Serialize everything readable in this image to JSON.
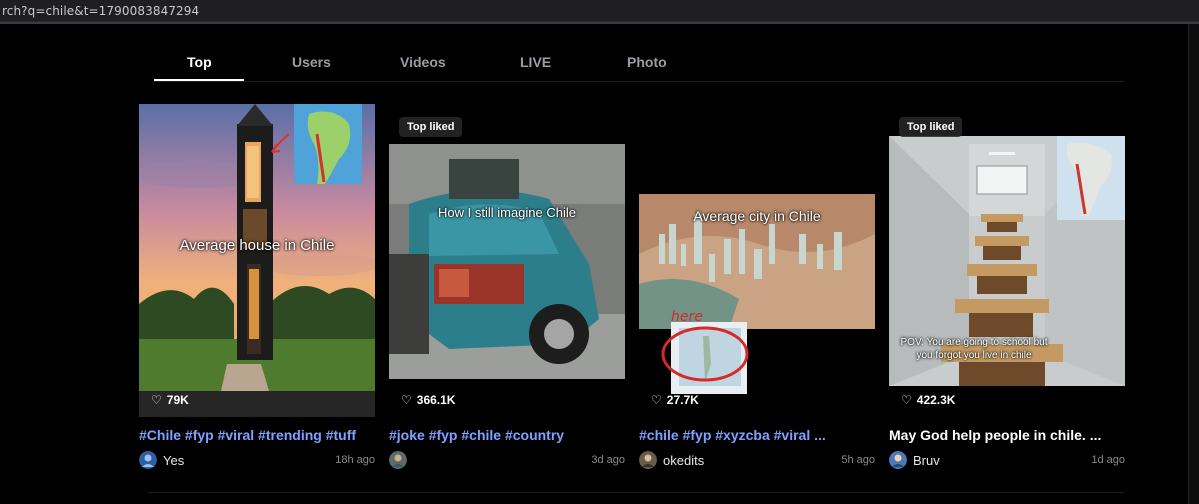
{
  "browser": {
    "url": "rch?q=chile&t=1790083847294"
  },
  "tabs": [
    {
      "label": "Top"
    },
    {
      "label": "Users"
    },
    {
      "label": "Videos"
    },
    {
      "label": "LIVE"
    },
    {
      "label": "Photo"
    }
  ],
  "cards": [
    {
      "overlay": "Average house in Chile",
      "likes": "79K",
      "description": "#Chile #fyp #viral #trending #tuff",
      "author": "Yes",
      "age": "18h ago"
    },
    {
      "badge": "Top liked",
      "overlay": "How I still imagine Chile",
      "likes": "366.1K",
      "description": "#joke #fyp #chile #country",
      "author": "",
      "age": "3d ago"
    },
    {
      "overlay": "Average city in Chile",
      "annotation": "here",
      "likes": "27.7K",
      "description": "#chile #fyp #xyzcba #viral ...",
      "author": "okedits",
      "age": "5h ago"
    },
    {
      "badge": "Top liked",
      "overlay": "POV: You are going to school but you forgot you live in chile",
      "likes": "422.3K",
      "description": "May God help people in chile. ...",
      "author": "Bruv",
      "age": "1d ago"
    }
  ]
}
